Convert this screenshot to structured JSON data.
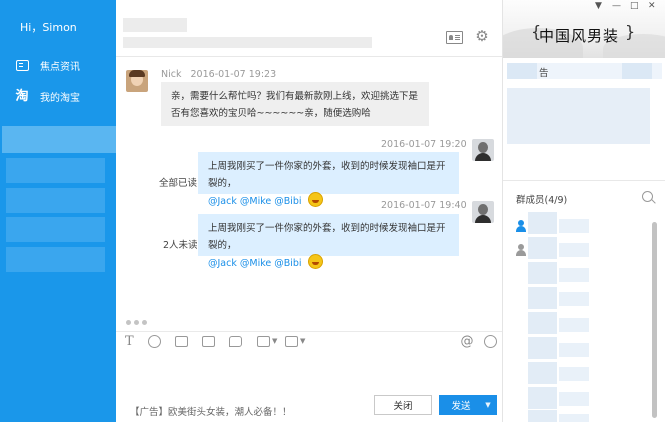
{
  "sidebar": {
    "greeting": "Hi，Simon",
    "nav": [
      {
        "label": "焦点资讯",
        "icon": "news-icon"
      },
      {
        "label": "我的淘宝",
        "icon": "taobao-icon"
      }
    ]
  },
  "chat": {
    "messages": [
      {
        "sender": "Nick",
        "time": "2016-01-07  19:23",
        "text": "亲，需要什么帮忙吗？我们有最新款刚上线，欢迎挑选下是否有您喜欢的宝贝哈~~~~~~亲，随便选购哈",
        "direction": "incoming"
      },
      {
        "time": "2016-01-07  19:20",
        "text": "上周我刚买了一件你家的外套，收到的时候发现袖口是开裂的，",
        "mentions": "@Jack @Mike @Bibi",
        "status": "全部已读",
        "direction": "outgoing"
      },
      {
        "time": "2016-01-07  19:40",
        "text": "上周我刚买了一件你家的外套，收到的时候发现袖口是开裂的，",
        "mentions": "@Jack @Mike @Bibi",
        "status": "2人未读",
        "direction": "outgoing"
      }
    ],
    "toolbar": [
      "text-format-icon",
      "emoji-icon",
      "image-icon",
      "screenshot-icon",
      "chat-bubble-icon",
      "crop-icon",
      "table-icon",
      "at-icon",
      "history-icon"
    ]
  },
  "footer": {
    "ad": "【广告】欧美街头女装，潮人必备！！",
    "close_label": "关闭",
    "send_label": "发送"
  },
  "right": {
    "shop_title": "中国风男装",
    "notice_label": "告",
    "members_title": "群成员(4/9)"
  },
  "colors": {
    "accent": "#1a97ea",
    "send_button": "#1a8fe8",
    "outgoing_bubble": "#dcefff",
    "incoming_bubble": "#efefef",
    "mention": "#1a8fe8"
  }
}
